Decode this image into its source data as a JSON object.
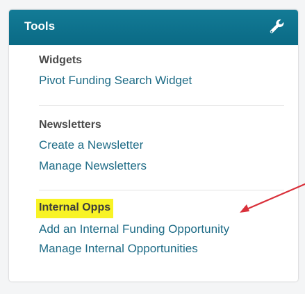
{
  "panel": {
    "title": "Tools",
    "header_color": "#0e7390",
    "header_icon": "wrench-icon"
  },
  "sections": [
    {
      "title": "Widgets",
      "links": [
        "Pivot Funding Search Widget"
      ]
    },
    {
      "title": "Newsletters",
      "links": [
        "Create a Newsletter",
        "Manage Newsletters"
      ]
    },
    {
      "title": "Internal Opps",
      "links": [
        "Add an Internal Funding Opportunity",
        "Manage Internal Opportunities"
      ]
    }
  ],
  "annotation": {
    "highlight_color": "#f8f325",
    "arrow_color": "#d9303a",
    "arrow_icon": "red-arrow-icon"
  },
  "colors": {
    "link": "#1d6b86",
    "section_title": "#4a4a4a"
  }
}
